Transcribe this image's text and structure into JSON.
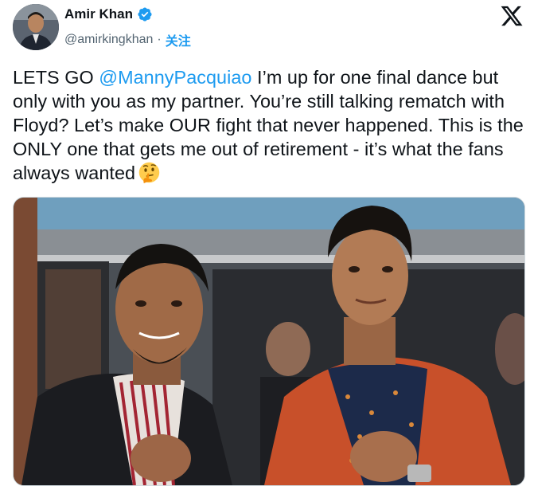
{
  "author": {
    "display_name": "Amir Khan",
    "handle": "@amirkingkhan",
    "separator": "·",
    "follow_label": "关注",
    "verified_icon": "verified-badge-icon",
    "avatar_icon": "profile-photo"
  },
  "platform": {
    "logo_icon": "x-logo-icon"
  },
  "tweet": {
    "text_before": "LETS GO ",
    "mention": "@MannyPacquiao",
    "text_after": " I’m up for one final dance but only with you as my partner. You’re still talking rematch with Floyd? Let’s make OUR fight that never happened. This is the ONLY one that gets me out of retirement - it’s what the fans always wanted",
    "emoji": "thinking-face-emoji"
  },
  "media": {
    "type": "photo",
    "icon": "photo-two-men-in-jackets"
  },
  "colors": {
    "link": "#1d9bf0",
    "text": "#0f1419",
    "secondary": "#536471",
    "verified": "#1d9bf0",
    "jacket_orange": "#c8502a"
  }
}
